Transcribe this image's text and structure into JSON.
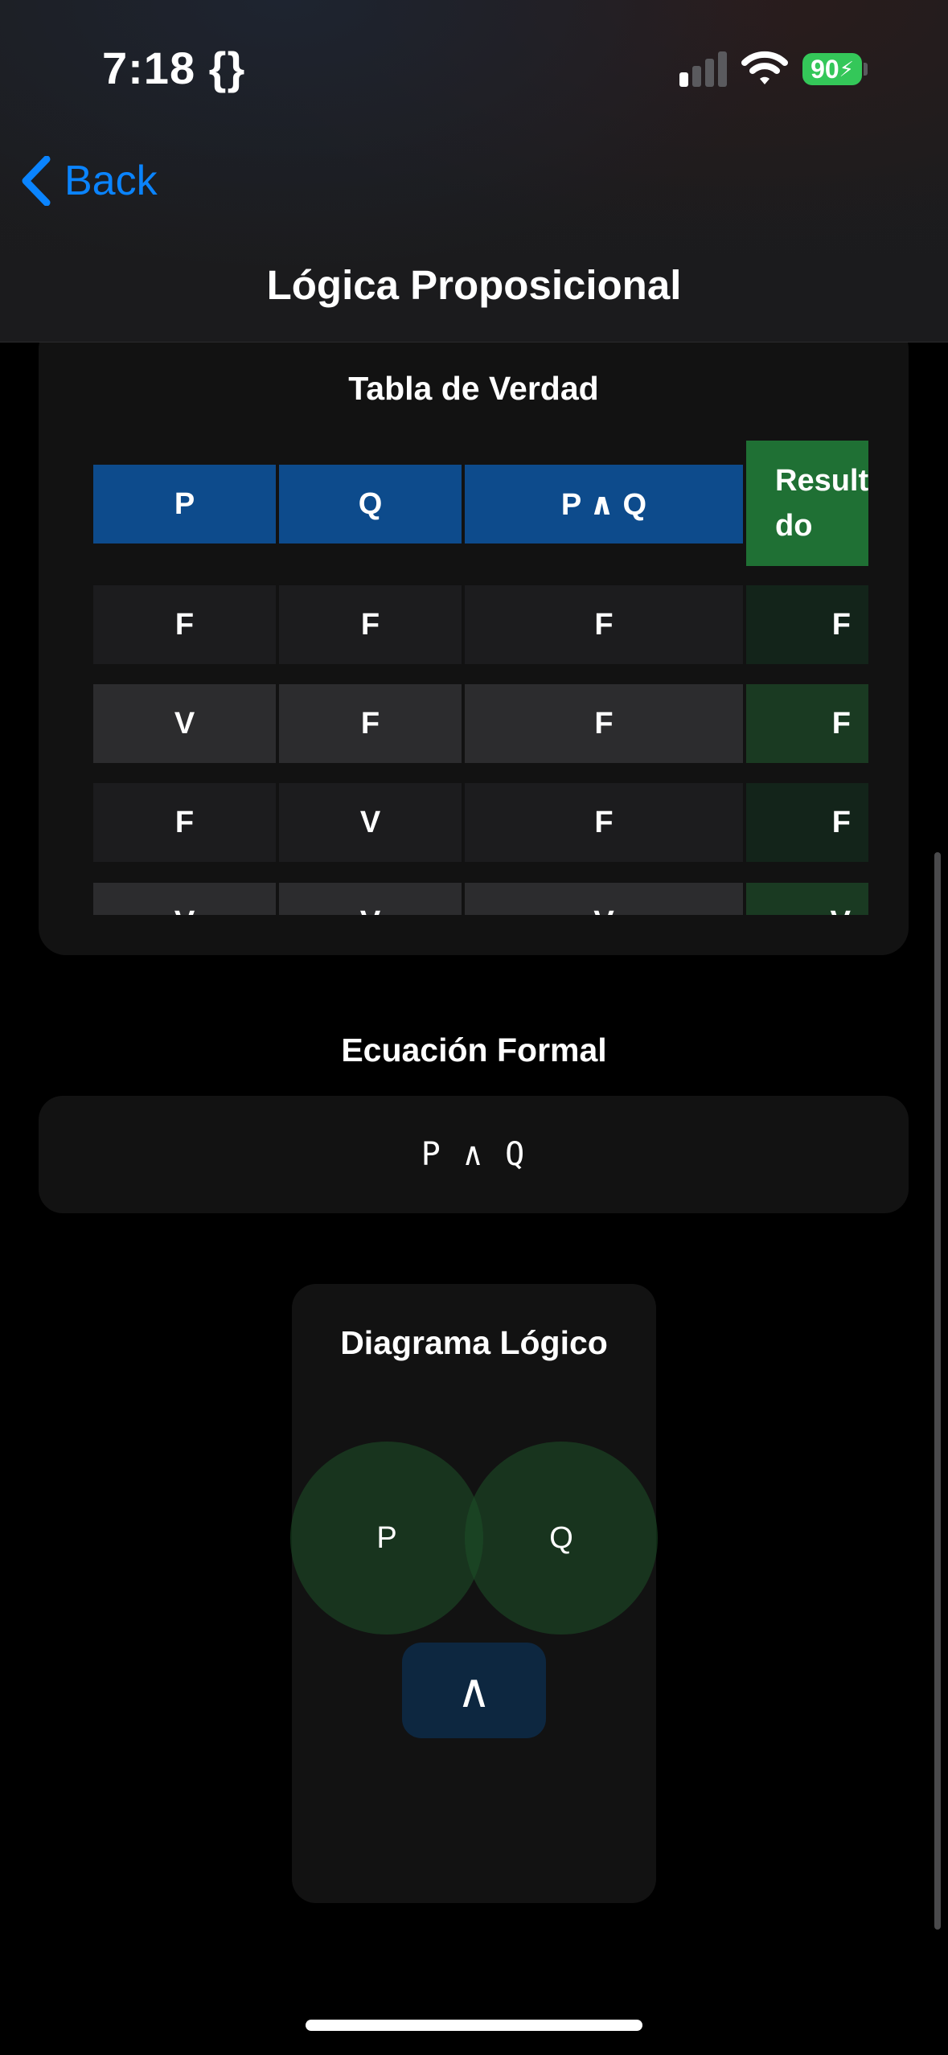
{
  "status_bar": {
    "time": "7:18",
    "time_suffix": "{}",
    "battery": "90"
  },
  "nav": {
    "back_label": "Back",
    "title": "Lógica Proposicional"
  },
  "truth_table": {
    "title": "Tabla de Verdad",
    "headers": [
      "P",
      "Q",
      "P ∧ Q",
      "Resultado"
    ],
    "result_header_line1": "Result",
    "result_header_line2": "do",
    "rows": [
      [
        "F",
        "F",
        "F",
        "F"
      ],
      [
        "V",
        "F",
        "F",
        "F"
      ],
      [
        "F",
        "V",
        "F",
        "F"
      ],
      [
        "V",
        "V",
        "V",
        "V"
      ]
    ]
  },
  "equation": {
    "title": "Ecuación Formal",
    "text": "P ∧ Q"
  },
  "diagram": {
    "title": "Diagrama Lógico",
    "left_label": "P",
    "right_label": "Q",
    "operator": "∧"
  },
  "colors": {
    "accent": "#0a84ff",
    "header_blue": "#0d4b8c",
    "result_green": "#1f7034",
    "battery_green": "#34c759"
  }
}
